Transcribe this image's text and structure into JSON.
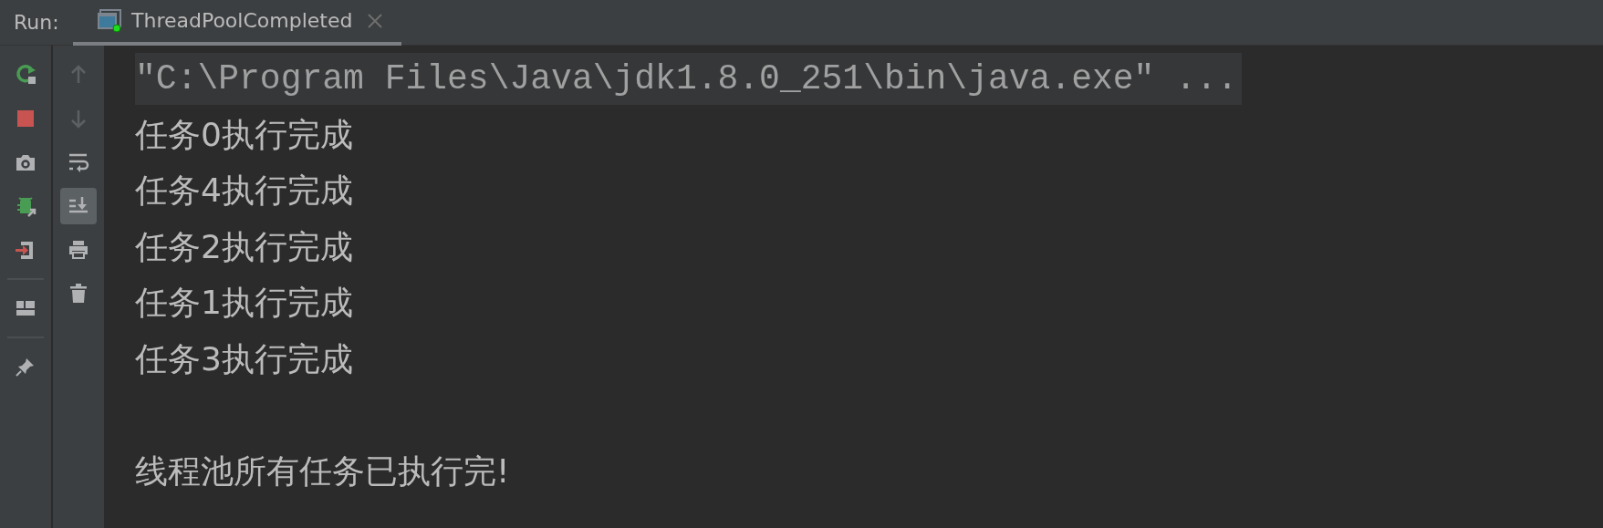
{
  "tool_window": {
    "label": "Run:"
  },
  "tabs": [
    {
      "label": "ThreadPoolCompleted",
      "selected": true,
      "running": true
    }
  ],
  "run_toolbar": [
    {
      "kind": "rerun"
    },
    {
      "kind": "stop"
    },
    {
      "kind": "snapshot"
    },
    {
      "kind": "debug"
    },
    {
      "kind": "exit"
    },
    {
      "kind": "separator"
    },
    {
      "kind": "layout"
    },
    {
      "kind": "separator"
    },
    {
      "kind": "pin"
    }
  ],
  "console_toolbar": [
    {
      "kind": "up",
      "disabled": true,
      "on": false
    },
    {
      "kind": "down",
      "disabled": true,
      "on": false
    },
    {
      "kind": "wrap",
      "disabled": false,
      "on": false
    },
    {
      "kind": "scroll-end",
      "disabled": false,
      "on": true
    },
    {
      "kind": "print",
      "disabled": false,
      "on": false
    },
    {
      "kind": "trash",
      "disabled": false,
      "on": false
    }
  ],
  "console": [
    {
      "kind": "command",
      "text": "\"C:\\Program Files\\Java\\jdk1.8.0_251\\bin\\java.exe\" ..."
    },
    {
      "kind": "output",
      "text": "任务0执行完成"
    },
    {
      "kind": "output",
      "text": "任务4执行完成"
    },
    {
      "kind": "output",
      "text": "任务2执行完成"
    },
    {
      "kind": "output",
      "text": "任务1执行完成"
    },
    {
      "kind": "output",
      "text": "任务3执行完成"
    },
    {
      "kind": "blank"
    },
    {
      "kind": "output",
      "text": "线程池所有任务已执行完!"
    }
  ]
}
